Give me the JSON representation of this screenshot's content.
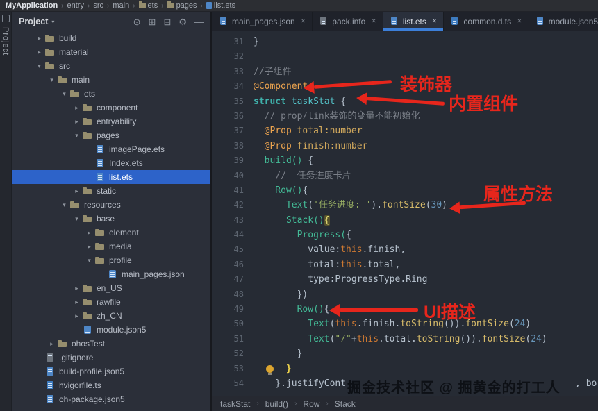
{
  "top_bar": {
    "separator": "›",
    "items": [
      {
        "label": "MyApplication",
        "bold": true
      },
      {
        "label": "entry"
      },
      {
        "label": "src"
      },
      {
        "label": "main"
      },
      {
        "label": "ets",
        "icon": "folder"
      },
      {
        "label": "pages",
        "icon": "folder"
      },
      {
        "label": "list.ets",
        "icon": "file"
      }
    ]
  },
  "tool_strip": {
    "label": "Project"
  },
  "project_panel": {
    "title": "Project",
    "caret": "▾",
    "chevron_expanded": "▾",
    "chevron_collapsed": "▸",
    "toolbar_icons": [
      {
        "name": "locate-file-icon",
        "glyph": "⊙"
      },
      {
        "name": "expand-all-icon",
        "glyph": "⊞"
      },
      {
        "name": "collapse-all-icon",
        "glyph": "⊟"
      },
      {
        "name": "settings-gear-icon",
        "glyph": "⚙"
      },
      {
        "name": "hide-panel-icon",
        "glyph": "—"
      }
    ],
    "tree": [
      {
        "label": "build",
        "type": "folder",
        "depth": 1,
        "state": "collapsed"
      },
      {
        "label": "material",
        "type": "folder",
        "depth": 1,
        "state": "collapsed"
      },
      {
        "label": "src",
        "type": "folder",
        "depth": 1,
        "state": "expanded"
      },
      {
        "label": "main",
        "type": "folder",
        "depth": 2,
        "state": "expanded"
      },
      {
        "label": "ets",
        "type": "folder",
        "depth": 3,
        "state": "expanded"
      },
      {
        "label": "component",
        "type": "folder",
        "depth": 4,
        "state": "collapsed"
      },
      {
        "label": "entryability",
        "type": "folder",
        "depth": 4,
        "state": "collapsed"
      },
      {
        "label": "pages",
        "type": "folder",
        "depth": 4,
        "state": "expanded"
      },
      {
        "label": "imagePage.ets",
        "type": "ets",
        "depth": 5
      },
      {
        "label": "Index.ets",
        "type": "ets",
        "depth": 5
      },
      {
        "label": "list.ets",
        "type": "ets",
        "depth": 5,
        "selected": true
      },
      {
        "label": "static",
        "type": "folder",
        "depth": 4,
        "state": "collapsed"
      },
      {
        "label": "resources",
        "type": "folder",
        "depth": 3,
        "state": "expanded"
      },
      {
        "label": "base",
        "type": "folder",
        "depth": 4,
        "state": "expanded"
      },
      {
        "label": "element",
        "type": "folder",
        "depth": 5,
        "state": "collapsed"
      },
      {
        "label": "media",
        "type": "folder",
        "depth": 5,
        "state": "collapsed"
      },
      {
        "label": "profile",
        "type": "folder",
        "depth": 5,
        "state": "expanded"
      },
      {
        "label": "main_pages.json",
        "type": "json",
        "depth": 6
      },
      {
        "label": "en_US",
        "type": "folder",
        "depth": 4,
        "state": "collapsed"
      },
      {
        "label": "rawfile",
        "type": "folder",
        "depth": 4,
        "state": "collapsed"
      },
      {
        "label": "zh_CN",
        "type": "folder",
        "depth": 4,
        "state": "collapsed"
      },
      {
        "label": "module.json5",
        "type": "json",
        "depth": 4
      },
      {
        "label": "ohosTest",
        "type": "folder",
        "depth": 2,
        "state": "collapsed"
      },
      {
        "label": ".gitignore",
        "type": "plain",
        "depth": 1
      },
      {
        "label": "build-profile.json5",
        "type": "json",
        "depth": 1
      },
      {
        "label": "hvigorfile.ts",
        "type": "ts",
        "depth": 1
      },
      {
        "label": "oh-package.json5",
        "type": "json",
        "depth": 1
      }
    ]
  },
  "editor": {
    "close_glyph": "✕",
    "status_separator": "›",
    "tabs": [
      {
        "label": "main_pages.json",
        "icon": "json",
        "active": false
      },
      {
        "label": "pack.info",
        "icon": "info",
        "active": false
      },
      {
        "label": "list.ets",
        "icon": "ets",
        "active": true
      },
      {
        "label": "common.d.ts",
        "icon": "dts",
        "active": false
      },
      {
        "label": "module.json5",
        "icon": "json",
        "active": false
      }
    ],
    "lines": [
      {
        "n": 31,
        "indent": 0,
        "seg": [
          [
            "}",
            "fg"
          ]
        ]
      },
      {
        "n": 32,
        "indent": 0,
        "seg": []
      },
      {
        "n": 33,
        "indent": 0,
        "seg": [
          [
            "//子组件",
            "com"
          ]
        ]
      },
      {
        "n": 34,
        "indent": 0,
        "seg": [
          [
            "@Component",
            "ann"
          ]
        ]
      },
      {
        "n": 35,
        "indent": 0,
        "seg": [
          [
            "struct ",
            "kwt"
          ],
          [
            "taskStat ",
            "typ"
          ],
          [
            "{",
            "fg"
          ]
        ]
      },
      {
        "n": 36,
        "indent": 2,
        "seg": [
          [
            "// prop/link装饰的变量不能初始化",
            "com"
          ]
        ]
      },
      {
        "n": 37,
        "indent": 2,
        "seg": [
          [
            "@Prop ",
            "ann"
          ],
          [
            "total:number",
            "prop"
          ]
        ]
      },
      {
        "n": 38,
        "indent": 2,
        "seg": [
          [
            "@Prop ",
            "ann"
          ],
          [
            "finish:number",
            "prop"
          ]
        ]
      },
      {
        "n": 39,
        "indent": 2,
        "seg": [
          [
            "build() ",
            "call"
          ],
          [
            "{",
            "fg"
          ]
        ]
      },
      {
        "n": 40,
        "indent": 4,
        "seg": [
          [
            "//  任务进度卡片",
            "com"
          ]
        ]
      },
      {
        "n": 41,
        "indent": 4,
        "seg": [
          [
            "Row()",
            "call"
          ],
          [
            "{",
            "fg"
          ]
        ]
      },
      {
        "n": 42,
        "indent": 6,
        "seg": [
          [
            "Text",
            "call"
          ],
          [
            "(",
            "fg"
          ],
          [
            "'任务进度: '",
            "str"
          ],
          [
            ").",
            "fg"
          ],
          [
            "fontSize",
            "mem"
          ],
          [
            "(",
            "fg"
          ],
          [
            "30",
            "num"
          ],
          [
            ")",
            "fg"
          ]
        ]
      },
      {
        "n": 43,
        "indent": 6,
        "seg": [
          [
            "Stack()",
            "call"
          ],
          [
            "{",
            "brhl"
          ]
        ]
      },
      {
        "n": 44,
        "indent": 8,
        "seg": [
          [
            "Progress(",
            "call"
          ],
          [
            "{",
            "fg"
          ]
        ]
      },
      {
        "n": 45,
        "indent": 10,
        "seg": [
          [
            "value:",
            "fg"
          ],
          [
            "this",
            "kw"
          ],
          [
            ".finish,",
            "fg"
          ]
        ]
      },
      {
        "n": 46,
        "indent": 10,
        "seg": [
          [
            "total:",
            "fg"
          ],
          [
            "this",
            "kw"
          ],
          [
            ".total,",
            "fg"
          ]
        ]
      },
      {
        "n": 47,
        "indent": 10,
        "seg": [
          [
            "type:ProgressType.Ring",
            "fg"
          ]
        ]
      },
      {
        "n": 48,
        "indent": 8,
        "seg": [
          [
            "})",
            "fg"
          ]
        ]
      },
      {
        "n": 49,
        "indent": 8,
        "seg": [
          [
            "Row()",
            "call"
          ],
          [
            "{",
            "fg"
          ]
        ]
      },
      {
        "n": 50,
        "indent": 10,
        "seg": [
          [
            "Text",
            "call"
          ],
          [
            "(",
            "fg"
          ],
          [
            "this",
            "kw"
          ],
          [
            ".finish.",
            "fg"
          ],
          [
            "toString",
            "mem"
          ],
          [
            "()).",
            "fg"
          ],
          [
            "fontSize",
            "mem"
          ],
          [
            "(",
            "fg"
          ],
          [
            "24",
            "num"
          ],
          [
            ")",
            "fg"
          ]
        ]
      },
      {
        "n": 51,
        "indent": 10,
        "seg": [
          [
            "Text",
            "call"
          ],
          [
            "(",
            "fg"
          ],
          [
            "\"/\"",
            "str"
          ],
          [
            "+",
            "fg"
          ],
          [
            "this",
            "kw"
          ],
          [
            ".total.",
            "fg"
          ],
          [
            "toString",
            "mem"
          ],
          [
            "()).",
            "fg"
          ],
          [
            "fontSize",
            "mem"
          ],
          [
            "(",
            "fg"
          ],
          [
            "24",
            "num"
          ],
          [
            ")",
            "fg"
          ]
        ]
      },
      {
        "n": 52,
        "indent": 8,
        "seg": [
          [
            "}",
            "fg"
          ]
        ]
      },
      {
        "n": 53,
        "indent": 6,
        "bulb": true,
        "seg": [
          [
            "}",
            "brhl2"
          ]
        ]
      },
      {
        "n": 54,
        "indent": 4,
        "seg": [
          [
            "}.justifyCont",
            "fg"
          ],
          [
            "",
            "gap"
          ],
          [
            ", bo",
            "fg"
          ]
        ]
      }
    ],
    "status_breadcrumbs": [
      "taskStat",
      "build()",
      "Row",
      "Stack"
    ]
  },
  "annotations": {
    "color": "#e7261c",
    "items": [
      {
        "label": "装饰器"
      },
      {
        "label": "内置组件"
      },
      {
        "label": "属性方法"
      },
      {
        "label": "UI描述"
      }
    ]
  },
  "watermark": "掘金技术社区 @ 掘黄金的打工人"
}
